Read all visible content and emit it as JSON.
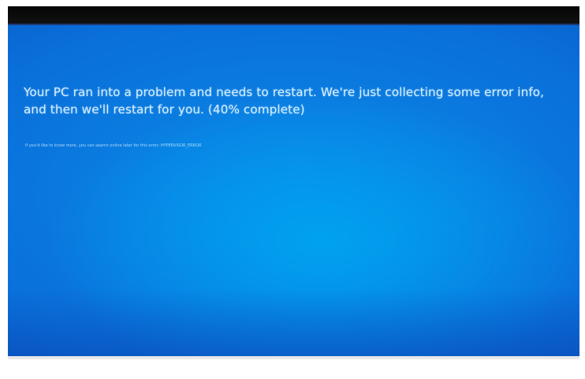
{
  "screen": {
    "background_color": "#0a7ae0",
    "message": "Your PC ran into a problem and needs to restart. We're just collecting some error info, and then we'll restart for you. (40% complete)",
    "progress_percent": 40,
    "detail": "If you'd like to know more, you can search online later for this error: HYPERVISOR_ERROR"
  }
}
